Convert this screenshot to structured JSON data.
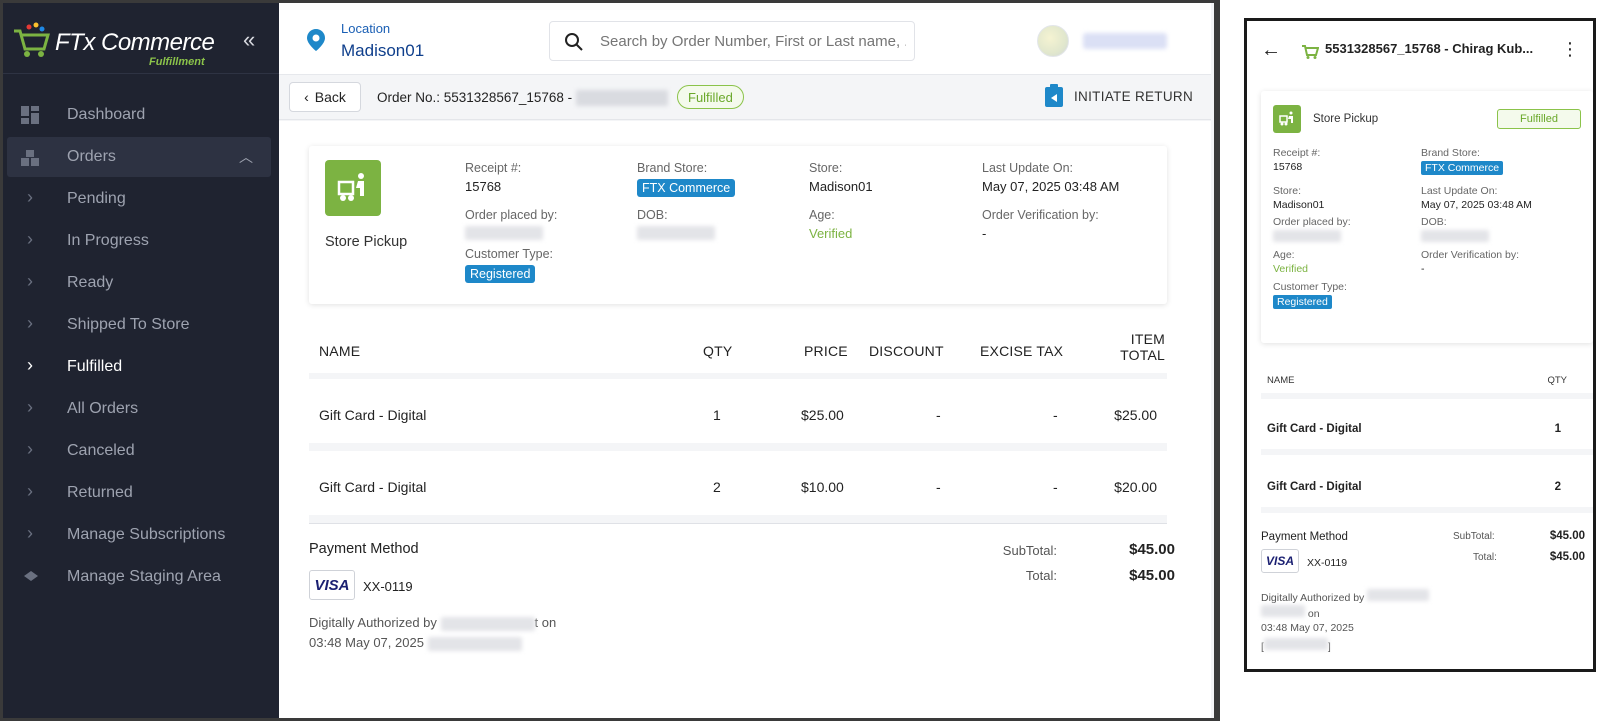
{
  "brand": {
    "name": "FTx Commerce",
    "subtitle": "Fulfillment"
  },
  "sidebar": {
    "items": [
      {
        "label": "Dashboard",
        "icon": "dashboard-icon"
      },
      {
        "label": "Orders",
        "icon": "orders-icon"
      },
      {
        "label": "Pending"
      },
      {
        "label": "In Progress"
      },
      {
        "label": "Ready"
      },
      {
        "label": "Shipped To Store"
      },
      {
        "label": "Fulfilled"
      },
      {
        "label": "All Orders"
      },
      {
        "label": "Canceled"
      },
      {
        "label": "Returned"
      },
      {
        "label": "Manage Subscriptions"
      },
      {
        "label": "Manage Staging Area",
        "icon": "staging-icon"
      }
    ]
  },
  "header": {
    "location_label": "Location",
    "location_value": "Madison01",
    "search_placeholder": "Search by Order Number, First or Last name, ..."
  },
  "subbar": {
    "back_label": "Back",
    "order_prefix": "Order No.: 5531328567_15768 -",
    "status": "Fulfilled",
    "initiate_return": "INITIATE RETURN"
  },
  "order": {
    "type": "Store Pickup",
    "receipt_label": "Receipt #:",
    "receipt_value": "15768",
    "brand_store_label": "Brand Store:",
    "brand_store_value": "FTX Commerce",
    "store_label": "Store:",
    "store_value": "Madison01",
    "last_update_label": "Last Update On:",
    "last_update_value": "May 07, 2025 03:48 AM",
    "placed_by_label": "Order placed by:",
    "dob_label": "DOB:",
    "age_label": "Age:",
    "age_value": "Verified",
    "verification_label": "Order Verification by:",
    "verification_value": "-",
    "customer_type_label": "Customer Type:",
    "customer_type_value": "Registered"
  },
  "table": {
    "headers": {
      "name": "NAME",
      "qty": "QTY",
      "price": "PRICE",
      "discount": "DISCOUNT",
      "excise": "EXCISE TAX",
      "total_line1": "ITEM",
      "total_line2": "TOTAL"
    },
    "rows": [
      {
        "name": "Gift Card - Digital",
        "qty": "1",
        "price": "$25.00",
        "discount": "-",
        "excise": "-",
        "total": "$25.00"
      },
      {
        "name": "Gift Card - Digital",
        "qty": "2",
        "price": "$10.00",
        "discount": "-",
        "excise": "-",
        "total": "$20.00"
      }
    ]
  },
  "payment": {
    "title": "Payment Method",
    "card_brand": "VISA",
    "card_number": "XX-0119",
    "auth_prefix": "Digitally Authorized by",
    "auth_suffix_char": "t on",
    "auth_time": "03:48 May 07, 2025",
    "subtotal_label": "SubTotal:",
    "subtotal_value": "$45.00",
    "total_label": "Total:",
    "total_value": "$45.00"
  },
  "mobile": {
    "title": "5531328567_15768 - Chirag Kub...",
    "type": "Store Pickup",
    "status": "Fulfilled",
    "receipt_label": "Receipt #:",
    "receipt_value": "15768",
    "brand_store_label": "Brand Store:",
    "brand_store_value": "FTX Commerce",
    "store_label": "Store:",
    "store_value": "Madison01",
    "last_update_label": "Last Update On:",
    "last_update_value": "May 07, 2025 03:48 AM",
    "placed_by_label": "Order placed by:",
    "dob_label": "DOB:",
    "age_label": "Age:",
    "age_value": "Verified",
    "verification_label": "Order Verification by:",
    "verification_value": "-",
    "customer_type_label": "Customer Type:",
    "customer_type_value": "Registered",
    "name_header": "NAME",
    "qty_header": "QTY",
    "rows": [
      {
        "name": "Gift Card - Digital",
        "qty": "1"
      },
      {
        "name": "Gift Card - Digital",
        "qty": "2"
      }
    ],
    "payment_title": "Payment Method",
    "card_brand": "VISA",
    "card_number": "XX-0119",
    "auth_prefix": "Digitally Authorized by",
    "auth_on": "on",
    "auth_time": "03:48 May 07, 2025",
    "bracket_open": "[",
    "bracket_close": "]",
    "subtotal_label": "SubTotal:",
    "subtotal_value": "$45.00",
    "total_label": "Total:",
    "total_value": "$45.00"
  },
  "colors": {
    "sidebar_bg": "#1f2330",
    "accent_green": "#7cb342",
    "accent_blue": "#1e88c9",
    "link_blue": "#1a5fb4"
  }
}
